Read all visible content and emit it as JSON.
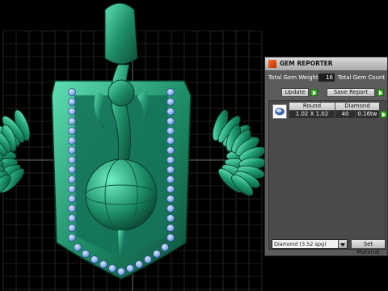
{
  "viewport": {
    "background": "#000000",
    "grid_color": "#3a3a3a",
    "model_color": "#1f8f6a",
    "gem_color": "#7fa8e8"
  },
  "panel": {
    "title": "GEM REPORTER",
    "title_icon": "gem-reporter-icon",
    "total_gem_weight_label": "Total Gem Weight",
    "total_gem_weight_value": "16",
    "total_gem_count_label": "Total Gem Count",
    "update_label": "Update",
    "save_report_label": "Save Report",
    "table": {
      "headers": [
        "Round",
        "Diamond"
      ],
      "row": {
        "icon": "round-gem-icon",
        "size": "1.02 X 1.02",
        "count": "40",
        "weight": "0.16tw"
      }
    },
    "material_select": "Diamond    (3.52 spg)",
    "set_material_label": "Set Material"
  }
}
